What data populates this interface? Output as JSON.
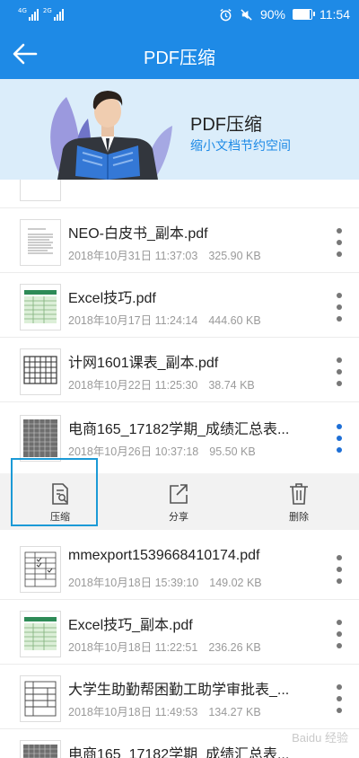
{
  "status_bar": {
    "sim1": "4G",
    "sim2": "2G",
    "battery": "90%",
    "time": "11:54"
  },
  "nav": {
    "title": "PDF压缩"
  },
  "banner": {
    "title": "PDF压缩",
    "subtitle": "缩小文档节约空间"
  },
  "files": [
    {
      "name": "NEO-白皮书_副本.pdf",
      "date": "2018年10月31日 11:37:03",
      "size": "325.90 KB",
      "thumb": "document-thumbnail"
    },
    {
      "name": "Excel技巧.pdf",
      "date": "2018年10月17日 11:24:14",
      "size": "444.60 KB",
      "thumb": "spreadsheet-thumbnail"
    },
    {
      "name": "计网1601课表_副本.pdf",
      "date": "2018年10月22日 11:25:30",
      "size": "38.74 KB",
      "thumb": "table-thumbnail"
    },
    {
      "name": "电商165_17182学期_成绩汇总表...",
      "date": "2018年10月26日 10:37:18",
      "size": "95.50 KB",
      "thumb": "grid-thumbnail"
    },
    {
      "name": "mmexport1539668410174.pdf",
      "date": "2018年10月18日 15:39:10",
      "size": "149.02 KB",
      "thumb": "form-thumbnail"
    },
    {
      "name": "Excel技巧_副本.pdf",
      "date": "2018年10月18日 11:22:51",
      "size": "236.26 KB",
      "thumb": "spreadsheet-thumbnail"
    },
    {
      "name": "大学生助勤帮困勤工助学审批表_...",
      "date": "2018年10月18日 11:49:53",
      "size": "134.27 KB",
      "thumb": "form-thumbnail"
    },
    {
      "name": "电商165_17182学期_成绩汇总表...",
      "date": "",
      "size": "",
      "thumb": "grid-thumbnail"
    }
  ],
  "actions": {
    "compress": "压缩",
    "share": "分享",
    "delete": "删除"
  },
  "watermark": "Baidu 经验",
  "colors": {
    "primary": "#1e8ae6",
    "banner_bg": "#dbedfa",
    "highlight": "#1b9ad6"
  }
}
